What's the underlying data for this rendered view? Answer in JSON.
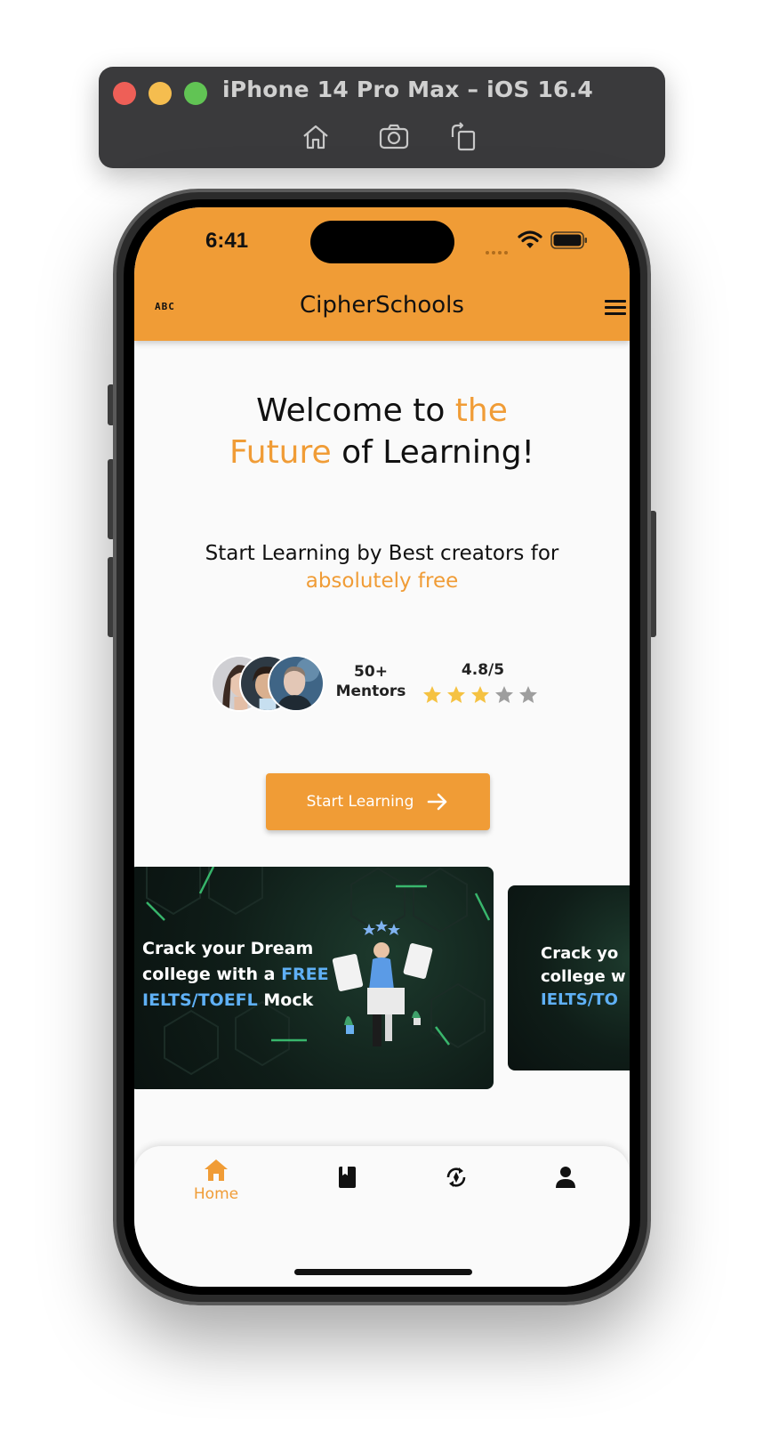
{
  "simulator": {
    "title": "iPhone 14 Pro Max – iOS 16.4",
    "tools": [
      "home-icon",
      "screenshot-icon",
      "rotate-icon"
    ]
  },
  "status_bar": {
    "time": "6:41",
    "icons": [
      "signal-icon",
      "wifi-icon",
      "battery-icon"
    ]
  },
  "app_bar": {
    "logo_text": "ABC",
    "title": "CipherSchools",
    "menu_icon": "hamburger-menu-icon",
    "color": "#f09c36"
  },
  "hero": {
    "line1_plain": "Welcome to ",
    "line1_accent": "the",
    "line2_accent": "Future",
    "line2_plain": " of Learning!"
  },
  "subtitle": {
    "plain": "Start Learning by Best creators for",
    "accent": "absolutely free"
  },
  "stats": {
    "mentors_count": "50+",
    "mentors_label": "Mentors",
    "rating_text": "4.8/5",
    "stars_filled": 3,
    "stars_total": 5
  },
  "cta": {
    "label": "Start Learning",
    "icon": "arrow-right-icon"
  },
  "banners": [
    {
      "line1": "Crack your Dream",
      "line2_plain": "college with a ",
      "line2_accent": "FREE",
      "line3_accent": "IELTS/TOEFL",
      "line3_plain": " Mock"
    },
    {
      "line1": "Crack yo",
      "line2_plain": "college w",
      "line3_accent": "IELTS/TO"
    }
  ],
  "bottom_nav": {
    "items": [
      {
        "label": "Home",
        "icon": "home-icon",
        "active": true
      },
      {
        "label": "",
        "icon": "book-icon",
        "active": false
      },
      {
        "label": "",
        "icon": "trending-icon",
        "active": false
      },
      {
        "label": "",
        "icon": "person-icon",
        "active": false
      }
    ],
    "accent": "#f09c36"
  },
  "colors": {
    "accent": "#f09c36",
    "banner_highlight": "#5fb0f5",
    "star_filled": "#f5c242",
    "star_empty": "#9e9e9e"
  }
}
